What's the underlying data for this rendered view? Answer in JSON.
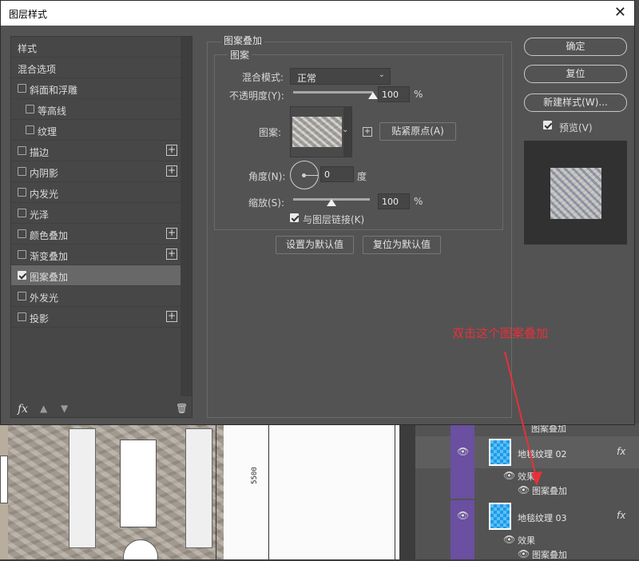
{
  "dialog": {
    "title": "图层样式",
    "style_list": {
      "items": [
        {
          "label": "样式",
          "checkbox": false,
          "checked": false,
          "plus": false,
          "indent": 0,
          "active": false
        },
        {
          "label": "混合选项",
          "checkbox": false,
          "checked": false,
          "plus": false,
          "indent": 0,
          "active": false
        },
        {
          "label": "斜面和浮雕",
          "checkbox": true,
          "checked": false,
          "plus": false,
          "indent": 0,
          "active": false
        },
        {
          "label": "等高线",
          "checkbox": true,
          "checked": false,
          "plus": false,
          "indent": 1,
          "active": false
        },
        {
          "label": "纹理",
          "checkbox": true,
          "checked": false,
          "plus": false,
          "indent": 1,
          "active": false
        },
        {
          "label": "描边",
          "checkbox": true,
          "checked": false,
          "plus": true,
          "indent": 0,
          "active": false
        },
        {
          "label": "内阴影",
          "checkbox": true,
          "checked": false,
          "plus": true,
          "indent": 0,
          "active": false
        },
        {
          "label": "内发光",
          "checkbox": true,
          "checked": false,
          "plus": false,
          "indent": 0,
          "active": false
        },
        {
          "label": "光泽",
          "checkbox": true,
          "checked": false,
          "plus": false,
          "indent": 0,
          "active": false
        },
        {
          "label": "颜色叠加",
          "checkbox": true,
          "checked": false,
          "plus": true,
          "indent": 0,
          "active": false
        },
        {
          "label": "渐变叠加",
          "checkbox": true,
          "checked": false,
          "plus": true,
          "indent": 0,
          "active": false
        },
        {
          "label": "图案叠加",
          "checkbox": true,
          "checked": true,
          "plus": false,
          "indent": 0,
          "active": true
        },
        {
          "label": "外发光",
          "checkbox": true,
          "checked": false,
          "plus": false,
          "indent": 0,
          "active": false
        },
        {
          "label": "投影",
          "checkbox": true,
          "checked": false,
          "plus": true,
          "indent": 0,
          "active": false
        }
      ],
      "footer": {
        "fx": "fx",
        "up_icon": "arrow-up-icon",
        "down_icon": "arrow-down-icon",
        "trash_icon": "trash-icon"
      }
    },
    "pattern_overlay": {
      "group_title": "图案叠加",
      "subgroup_title": "图案",
      "blend_mode_label": "混合模式:",
      "blend_mode_value": "正常",
      "opacity_label": "不透明度(Y):",
      "opacity_value": "100",
      "opacity_level": 1.0,
      "opacity_unit": "%",
      "pattern_label": "图案:",
      "snap_origin_label": "贴紧原点(A)",
      "angle_label": "角度(N):",
      "angle_value": "0",
      "angle_unit": "度",
      "scale_label": "缩放(S):",
      "scale_value": "100",
      "scale_level": 0.5,
      "scale_unit": "%",
      "link_label": "与图层链接(K)",
      "link_checked": true,
      "make_default_label": "设置为默认值",
      "reset_default_label": "复位为默认值"
    },
    "buttons": {
      "ok": "确定",
      "reset": "复位",
      "new_style": "新建样式(W)...",
      "preview_label": "预览(V)",
      "preview_checked": true
    }
  },
  "layers": {
    "rows": [
      {
        "name": "图案叠加",
        "kind": "effect-partial"
      },
      {
        "name": "地毯纹理 02",
        "kind": "layer",
        "fx": "fx"
      },
      {
        "name": "效果",
        "kind": "effects"
      },
      {
        "name": "图案叠加",
        "kind": "effect"
      },
      {
        "name": "地毯纹理 03",
        "kind": "layer",
        "fx": "fx"
      },
      {
        "name": "效果",
        "kind": "effects"
      },
      {
        "name": "图案叠加",
        "kind": "effect"
      }
    ]
  },
  "canvas": {
    "dimension_text": "5500"
  },
  "annotation": {
    "text": "双击这个图案叠加",
    "color": "#e8303a"
  },
  "colors": {
    "dialog_bg": "#535353",
    "active_item": "#686868",
    "layer_accent": "#6b4fa0"
  }
}
